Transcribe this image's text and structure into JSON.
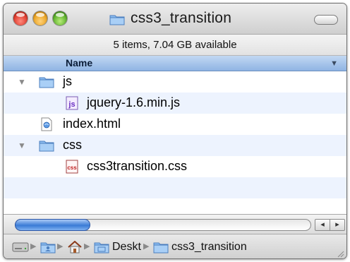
{
  "window": {
    "title": "css3_transition"
  },
  "status": {
    "text": "5 items, 7.04 GB available"
  },
  "columns": {
    "name": "Name"
  },
  "files": [
    {
      "label": "js",
      "kind": "folder",
      "expanded": true
    },
    {
      "label": "jquery-1.6.min.js",
      "kind": "js-file"
    },
    {
      "label": "index.html",
      "kind": "html-file"
    },
    {
      "label": "css",
      "kind": "folder",
      "expanded": true
    },
    {
      "label": "css3transition.css",
      "kind": "css-file"
    }
  ],
  "pathbar": {
    "items": [
      {
        "label": "",
        "icon": "hard-drive-icon"
      },
      {
        "label": "",
        "icon": "user-folder-icon"
      },
      {
        "label": "",
        "icon": "home-icon"
      },
      {
        "label": "Deskt",
        "icon": "desktop-folder-icon"
      },
      {
        "label": "css3_transition",
        "icon": "folder-icon"
      }
    ]
  },
  "scroll": {
    "position_fraction": 0.0
  },
  "icons": {
    "disclosure_open": "▼",
    "sort_arrow": "▼",
    "scroll_left": "◂",
    "scroll_right": "▸",
    "path_separator": "▶"
  },
  "colors": {
    "header_gradient_top": "#c2d8f3",
    "header_gradient_bottom": "#8fb4e3",
    "alt_row": "#edf3fe",
    "close": "#d72b1d",
    "minimize": "#e59a12",
    "zoom": "#4aa31c",
    "folder_blue": "#7fb0e6"
  }
}
